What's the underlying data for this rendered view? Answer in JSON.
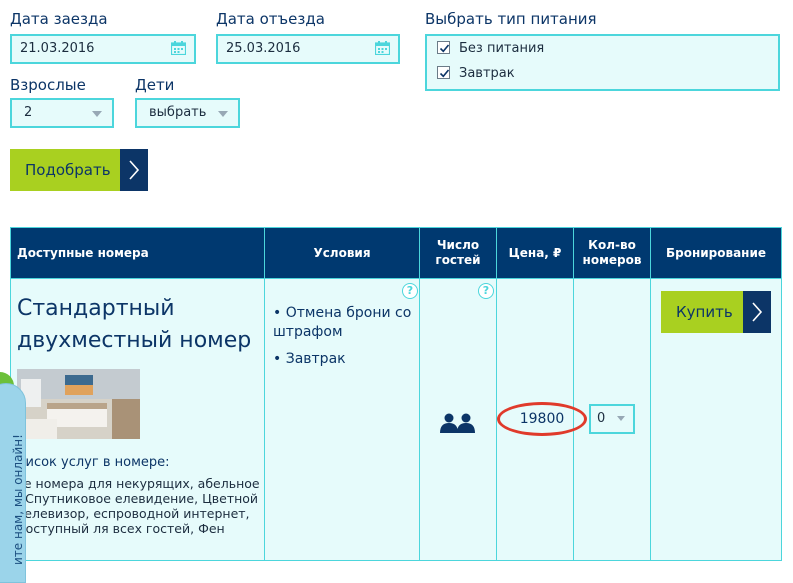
{
  "form": {
    "checkin_label": "Дата заезда",
    "checkin_value": "21.03.2016",
    "checkout_label": "Дата отъезда",
    "checkout_value": "25.03.2016",
    "meal_label": "Выбрать тип питания",
    "meal_options": [
      {
        "label": "Без питания",
        "checked": true
      },
      {
        "label": "Завтрак",
        "checked": true
      }
    ],
    "adults_label": "Взрослые",
    "adults_value": "2",
    "children_label": "Дети",
    "children_value": "выбрать",
    "submit_label": "Подобрать"
  },
  "table": {
    "headers": {
      "rooms": "Доступные номера",
      "conditions": "Условия",
      "guests": "Число гостей",
      "price": "Цена, ₽",
      "qty": "Кол-во номеров",
      "booking": "Бронирование"
    },
    "room": {
      "title": "Стандартный двухместный номер",
      "services_title": "писок услуг в номере:",
      "services_text": "се номера для некурящих, абельное / Спутниковое елевидение, Цветной телевизор, еспроводной интернет, доступный ля всех гостей, Фен",
      "conditions": [
        "Отмена брони со штрафом",
        "Завтрак"
      ],
      "price": "19800",
      "qty": "0",
      "buy_label": "Купить"
    },
    "help_symbol": "?"
  },
  "chat": {
    "text": "ите нам, мы онлайн!"
  },
  "colors": {
    "accent": "#a9d020",
    "navy": "#003970",
    "cyan": "#4cd6dc",
    "highlight": "#e03a2b"
  }
}
